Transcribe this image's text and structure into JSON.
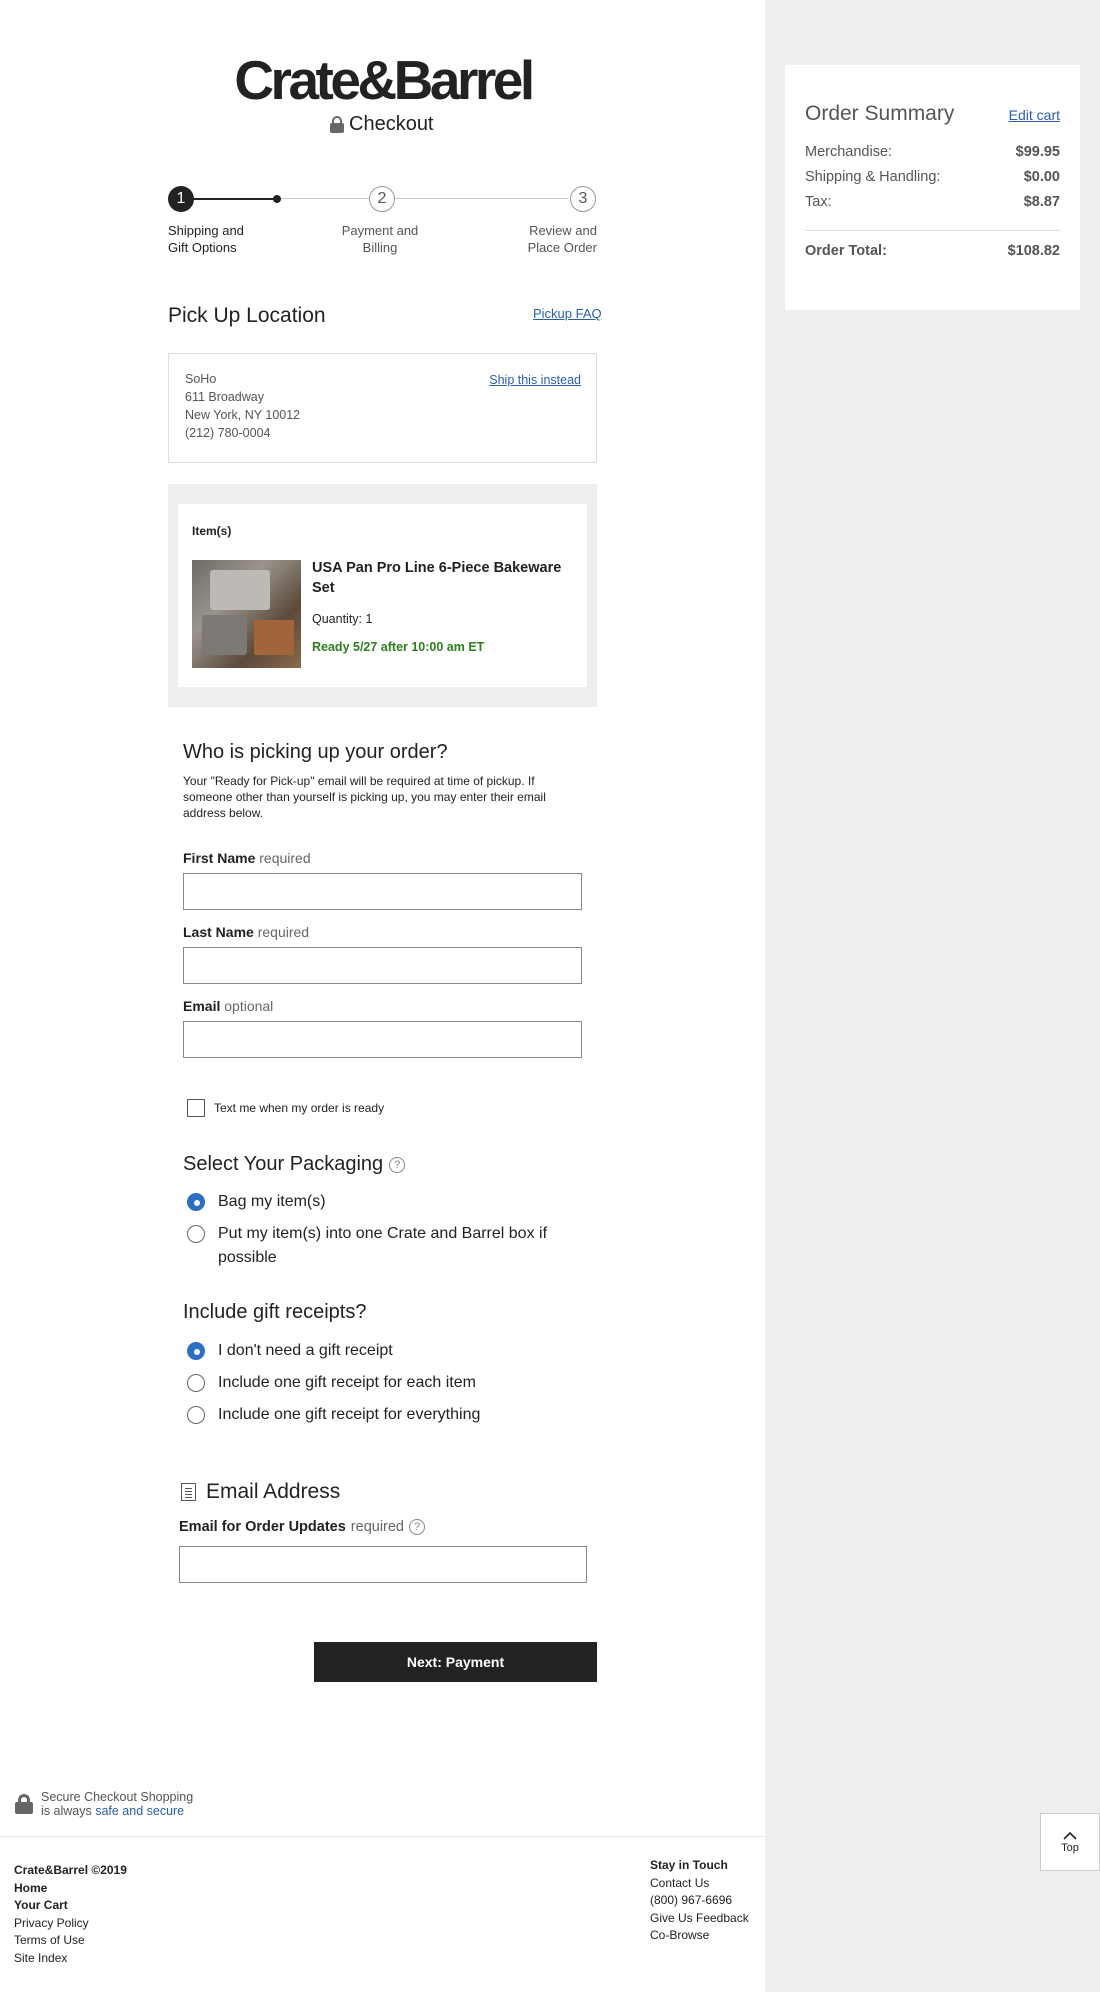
{
  "brand": {
    "logo_text": "Crate&Barrel",
    "checkout_label": "Checkout"
  },
  "progress": {
    "steps": [
      {
        "number": "1",
        "label_line1": "Shipping and",
        "label_line2": "Gift Options"
      },
      {
        "number": "2",
        "label_line1": "Payment and",
        "label_line2": "Billing"
      },
      {
        "number": "3",
        "label_line1": "Review and",
        "label_line2": "Place Order"
      }
    ]
  },
  "pickup": {
    "title": "Pick Up Location",
    "faq_link": "Pickup FAQ",
    "store_name": "SoHo",
    "address_line1": "611 Broadway",
    "address_line2": "New York, NY 10012",
    "phone": "(212) 780-0004",
    "ship_instead_link": "Ship this instead"
  },
  "items": {
    "label": "Item(s)",
    "product_name": "USA Pan Pro Line 6-Piece Bakeware Set",
    "quantity": "Quantity: 1",
    "ready_status": "Ready 5/27 after 10:00 am ET"
  },
  "pickup_person": {
    "title": "Who is picking up your order?",
    "description": "Your \"Ready for Pick-up\" email will be required at time of pickup. If someone other than yourself is picking up, you may enter their email address below.",
    "first_name_label": "First Name",
    "first_name_req": "required",
    "first_name_value": "",
    "last_name_label": "Last Name",
    "last_name_req": "required",
    "last_name_value": "",
    "email_label": "Email",
    "email_req": "optional",
    "email_value": "",
    "text_me_label": "Text me when my order is ready"
  },
  "packaging": {
    "title": "Select Your Packaging",
    "options": [
      {
        "label": "Bag my item(s)",
        "selected": true
      },
      {
        "label_line1": "Put my item(s) into one Crate and Barrel box if",
        "label_line2": "possible",
        "selected": false
      }
    ]
  },
  "gift": {
    "title": "Include gift receipts?",
    "options": [
      {
        "label": "I don't need a gift receipt",
        "selected": true
      },
      {
        "label": "Include one gift receipt for each item",
        "selected": false
      },
      {
        "label": "Include one gift receipt for everything",
        "selected": false
      }
    ]
  },
  "email_section": {
    "title": "Email Address",
    "label": "Email for Order Updates",
    "req": "required",
    "value": ""
  },
  "next_button": "Next: Payment",
  "order_summary": {
    "title": "Order Summary",
    "edit_link": "Edit cart",
    "rows": [
      {
        "label": "Merchandise:",
        "value": "$99.95"
      },
      {
        "label": "Shipping & Handling:",
        "value": "$0.00"
      },
      {
        "label": "Tax:",
        "value": "$8.87"
      }
    ],
    "total_label": "Order Total:",
    "total_value": "$108.82"
  },
  "secure": {
    "line1": "Secure Checkout Shopping",
    "line2_prefix": "is always ",
    "line2_link": "safe and secure"
  },
  "top_button": "Top",
  "footer": {
    "left": [
      "Crate&Barrel ©2019",
      "Home",
      "Your Cart",
      "Privacy Policy",
      "Terms of Use",
      "Site Index"
    ],
    "right_title": "Stay in Touch",
    "right": [
      "Contact Us",
      "(800) 967-6696",
      "Give Us  Feedback",
      "Co-Browse"
    ]
  },
  "colors": {
    "link": "#2a5fa8",
    "ready_green": "#2e7d1e",
    "radio_selected": "#2d6fbf",
    "panel_bg": "#efeeec"
  }
}
